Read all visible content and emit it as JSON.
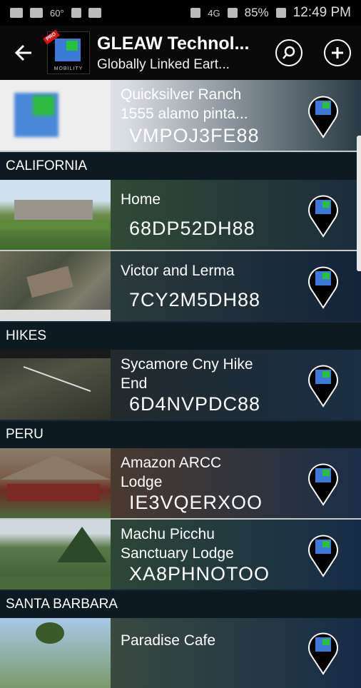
{
  "status_bar": {
    "temperature": "60°",
    "network": "4G",
    "battery": "85%",
    "time": "12:49 PM"
  },
  "app_bar": {
    "title": "GLEAW Technol...",
    "subtitle": "Globally Linked Eart...",
    "logo_text": "MOBILITY",
    "logo_ribbon": "PRO"
  },
  "top_item": {
    "name": "Quicksilver Ranch",
    "address": "1555 alamo pinta...",
    "code": "VMPOJ3FE88"
  },
  "sections": [
    {
      "header": "CALIFORNIA",
      "items": [
        {
          "name_line1": "Home",
          "name_line2": "",
          "code": "68DP52DH88"
        },
        {
          "name_line1": "Victor and Lerma",
          "name_line2": "",
          "code": "7CY2M5DH88"
        }
      ]
    },
    {
      "header": "HIKES",
      "items": [
        {
          "name_line1": "Sycamore Cny Hike",
          "name_line2": "End",
          "code": "6D4NVPDC88"
        }
      ]
    },
    {
      "header": "PERU",
      "items": [
        {
          "name_line1": "Amazon ARCC",
          "name_line2": "Lodge",
          "code": "IE3VQERXOO"
        },
        {
          "name_line1": "Machu Picchu",
          "name_line2": "Sanctuary Lodge",
          "code": "XA8PHNOTOO"
        }
      ]
    },
    {
      "header": "SANTA BARBARA",
      "items": [
        {
          "name_line1": "Paradise Cafe",
          "name_line2": "",
          "code": ""
        }
      ]
    }
  ],
  "icons": {
    "back": "arrow-left-icon",
    "search": "search-icon",
    "add": "plus-icon",
    "pin": "location-pin-icon"
  },
  "colors": {
    "accent_blue": "#3b7ad9",
    "accent_green": "#27c23a",
    "section_bg": "#0e1a22",
    "appbar_bg": "#0a0a0a"
  }
}
